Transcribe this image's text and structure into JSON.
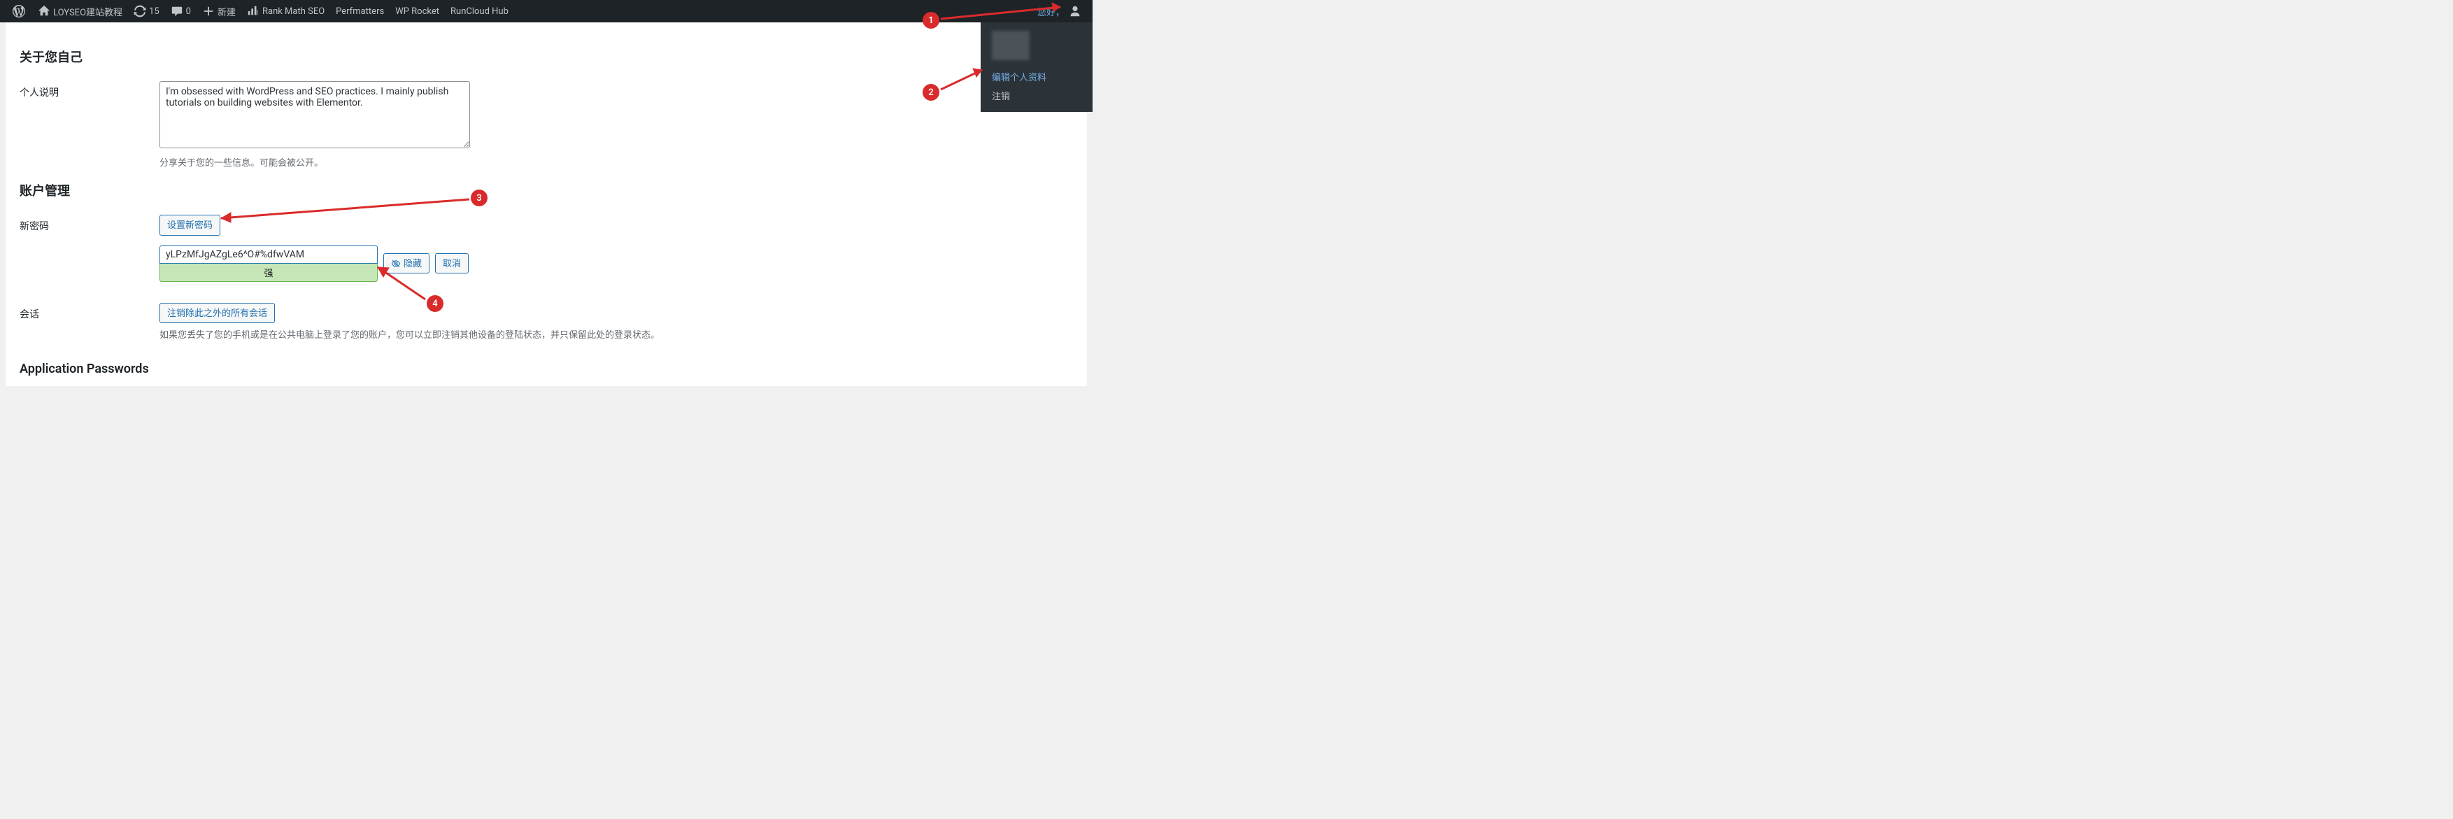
{
  "adminbar": {
    "site_title": "LOYSEO建站教程",
    "refresh_count": "15",
    "comments_count": "0",
    "new_label": "新建",
    "items": [
      "Rank Math SEO",
      "Perfmatters",
      "WP Rocket",
      "RunCloud Hub"
    ],
    "greeting": "您好，"
  },
  "user_menu": {
    "edit_profile": "编辑个人资料",
    "logout": "注销"
  },
  "sections": {
    "about_yourself": "关于您自己",
    "bio_label": "个人说明",
    "bio_value": "I'm obsessed with WordPress and SEO practices. I mainly publish tutorials on building websites with Elementor.",
    "bio_help": "分享关于您的一些信息。可能会被公开。",
    "account_mgmt": "账户管理",
    "new_password_label": "新密码",
    "set_new_password_btn": "设置新密码",
    "password_value": "yLPzMfJgAZgLe6^O#%dfwVAM",
    "hide_btn": "隐藏",
    "cancel_btn": "取消",
    "strength_text": "强",
    "sessions_label": "会话",
    "logout_everywhere_btn": "注销除此之外的所有会话",
    "sessions_help": "如果您丢失了您的手机或是在公共电脑上登录了您的账户，您可以立即注销其他设备的登陆状态，并只保留此处的登录状态。",
    "app_passwords": "Application Passwords"
  },
  "markers": {
    "1": "1",
    "2": "2",
    "3": "3",
    "4": "4"
  }
}
